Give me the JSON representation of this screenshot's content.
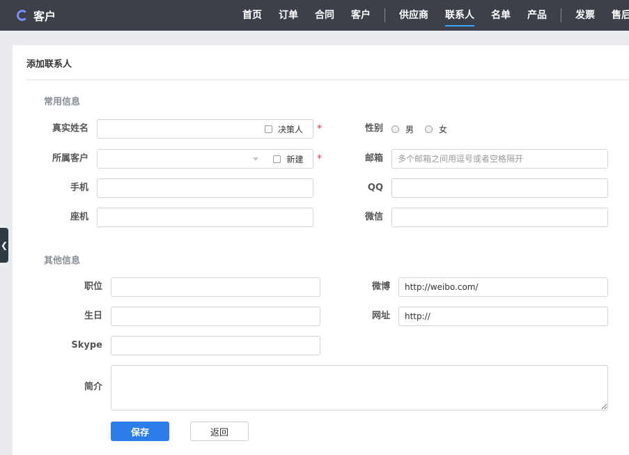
{
  "app": {
    "brand": "客户"
  },
  "nav": {
    "items": [
      "首页",
      "订单",
      "合同",
      "客户",
      "供应商",
      "联系人",
      "名单",
      "产品",
      "发票",
      "售后"
    ]
  },
  "panel": {
    "title": "添加联系人"
  },
  "sections": {
    "common": "常用信息",
    "other": "其他信息"
  },
  "form": {
    "real_name": {
      "label": "真实姓名",
      "value": "",
      "decision_maker_label": "决策人"
    },
    "gender": {
      "label": "性别",
      "male": "男",
      "female": "女"
    },
    "customer": {
      "label": "所属客户",
      "value": "",
      "new_label": "新建"
    },
    "email": {
      "label": "邮箱",
      "placeholder": "多个邮箱之间用逗号或者空格隔开"
    },
    "mobile": {
      "label": "手机",
      "value": ""
    },
    "qq": {
      "label": "QQ",
      "value": ""
    },
    "phone": {
      "label": "座机",
      "value": ""
    },
    "wechat": {
      "label": "微信",
      "value": ""
    },
    "position": {
      "label": "职位",
      "value": ""
    },
    "weibo": {
      "label": "微博",
      "value": "http://weibo.com/"
    },
    "birthday": {
      "label": "生日",
      "value": ""
    },
    "website": {
      "label": "网址",
      "value": "http://"
    },
    "skype": {
      "label": "Skype",
      "value": ""
    },
    "intro": {
      "label": "简介",
      "value": ""
    },
    "required_mark": "*"
  },
  "buttons": {
    "save": "保存",
    "back": "返回"
  },
  "colors": {
    "topbar": "#3b4049",
    "accent": "#2c7de9",
    "required": "#e2374b"
  }
}
